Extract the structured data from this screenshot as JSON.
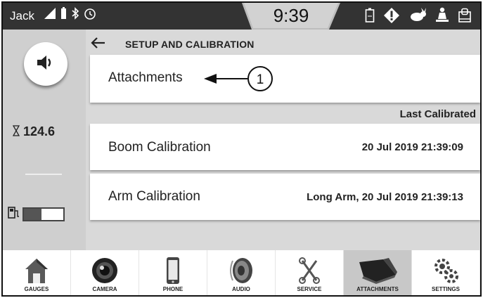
{
  "status_bar": {
    "user": "Jack",
    "time": "9:39",
    "left_icons": [
      "signal-icon",
      "battery-icon",
      "bluetooth-icon",
      "clock-icon"
    ],
    "right_icons": [
      "battery-status-icon",
      "warning-diamond-icon",
      "rabbit-speed-icon",
      "operator-icon",
      "fuel-display-icon"
    ]
  },
  "sidebar": {
    "hours": "124.6",
    "fuel_level": 0.45
  },
  "header": {
    "title": "SETUP AND CALIBRATION"
  },
  "rows": [
    {
      "label": "Attachments",
      "value": ""
    },
    {
      "label": "Boom Calibration",
      "value": "20 Jul 2019 21:39:09"
    },
    {
      "label": "Arm Calibration",
      "value": "Long Arm, 20 Jul 2019 21:39:13"
    }
  ],
  "last_calibrated_label": "Last Calibrated",
  "callout_number": "1",
  "nav": [
    {
      "label": "GAUGES",
      "icon": "house-icon"
    },
    {
      "label": "CAMERA",
      "icon": "camera-icon"
    },
    {
      "label": "PHONE",
      "icon": "phone-icon"
    },
    {
      "label": "AUDIO",
      "icon": "speaker-icon"
    },
    {
      "label": "SERVICE",
      "icon": "wrench-icon"
    },
    {
      "label": "ATTACHMENTS",
      "icon": "bucket-icon",
      "active": true
    },
    {
      "label": "SETTINGS",
      "icon": "gears-icon"
    }
  ]
}
